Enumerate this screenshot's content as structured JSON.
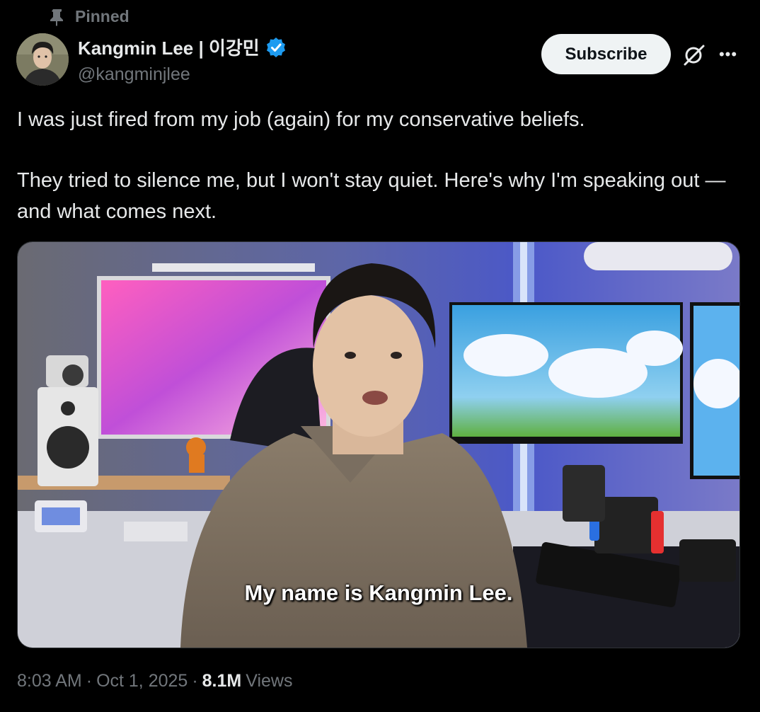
{
  "pinned": {
    "label": "Pinned"
  },
  "author": {
    "display_name": "Kangmin Lee | 이강민",
    "handle": "@kangminjlee",
    "verified": true,
    "verified_color": "#1d9bf0"
  },
  "actions": {
    "subscribe_label": "Subscribe",
    "grok_icon": "grok-icon",
    "more_icon": "more-icon"
  },
  "tweet": {
    "paragraphs": [
      "I was just fired from my job (again) for my conservative beliefs.",
      "They tried to silence me, but I won't stay quiet. Here's why I'm speaking out — and what comes next."
    ]
  },
  "media": {
    "type": "video",
    "caption": "My name is Kangmin Lee."
  },
  "meta": {
    "time": "8:03 AM",
    "separator": "·",
    "date": "Oct 1, 2025",
    "views_count": "8.1M",
    "views_label": "Views"
  }
}
